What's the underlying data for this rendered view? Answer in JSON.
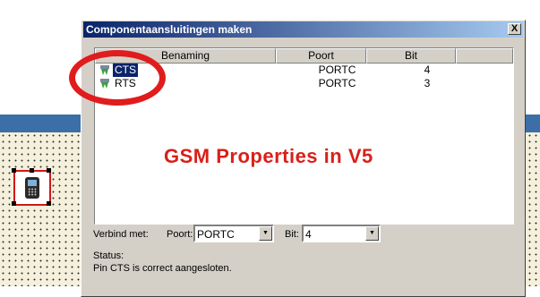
{
  "dialog": {
    "title": "Componentaansluitingen maken",
    "close_glyph": "X"
  },
  "list": {
    "columns": [
      "Benaming",
      "Poort",
      "Bit"
    ],
    "rows": [
      {
        "name": "CTS",
        "poort": "PORTC",
        "bit": "4",
        "icon": "pin-icon",
        "selected": true
      },
      {
        "name": "RTS",
        "poort": "PORTC",
        "bit": "3",
        "icon": "pin-icon",
        "selected": false
      }
    ]
  },
  "annotation": {
    "text": "GSM Properties in V5",
    "color": "#d8201a"
  },
  "connect": {
    "verbind_label": "Verbind met:",
    "poort_label": "Poort:",
    "poort_value": "PORTC",
    "bit_label": "Bit:",
    "bit_value": "4"
  },
  "status": {
    "label": "Status:",
    "message": "Pin CTS is correct aangesloten."
  },
  "background": {
    "component_icon": "mobile-phone-icon"
  }
}
